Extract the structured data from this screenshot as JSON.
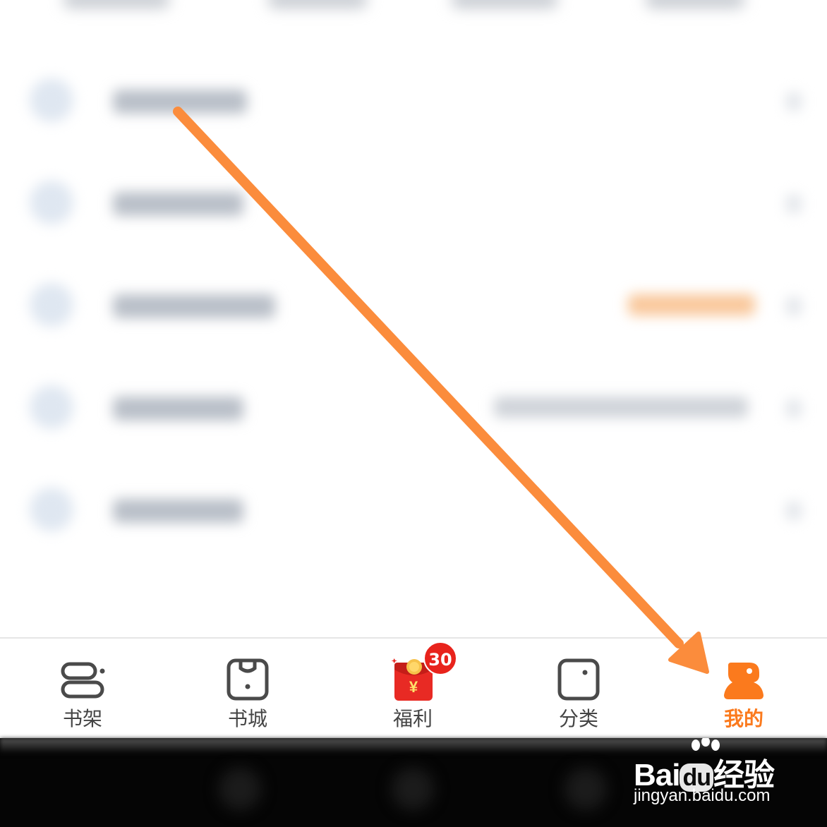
{
  "tabbar": {
    "tabs": [
      {
        "label": "书架",
        "icon": "bookshelf-icon",
        "active": false
      },
      {
        "label": "书城",
        "icon": "bookstore-icon",
        "active": false
      },
      {
        "label": "福利",
        "icon": "red-envelope-icon",
        "active": false,
        "badge": "30",
        "icon_text": "¥"
      },
      {
        "label": "分类",
        "icon": "category-icon",
        "active": false
      },
      {
        "label": "我的",
        "icon": "profile-icon",
        "active": true
      }
    ],
    "active_color": "#fb7a1d",
    "inactive_color": "#444444"
  },
  "watermark": {
    "brand_prefix": "Bai",
    "brand_mid": "du",
    "brand_suffix": "经验",
    "url": "jingyan.baidu.com"
  },
  "annotation": {
    "arrow_color": "#fb8c3c"
  }
}
